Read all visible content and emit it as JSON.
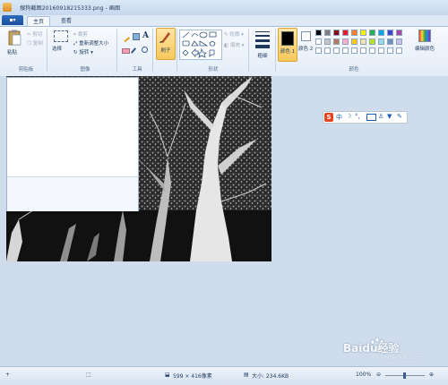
{
  "window": {
    "title": "搜狗截图20160918215333.png - 画图"
  },
  "tabs": [
    {
      "label": "主页"
    },
    {
      "label": "查看"
    }
  ],
  "clipboard": {
    "paste": "粘贴",
    "cut": "剪切",
    "copy": "复制",
    "group": "剪贴板"
  },
  "image": {
    "select": "选择",
    "crop": "裁剪",
    "resize": "重新调整大小",
    "rotate": "旋转",
    "group": "图像"
  },
  "tools": {
    "group": "工具",
    "text_glyph": "A"
  },
  "brushes": {
    "label": "刷子"
  },
  "shapes": {
    "outline": "轮廓",
    "fill": "填充",
    "group": "形状"
  },
  "size": {
    "label": "粗细"
  },
  "colors": {
    "color1": "颜色 1",
    "color2": "颜色 2",
    "edit": "编辑颜色",
    "group": "颜色",
    "palette": [
      "#000000",
      "#7f7f7f",
      "#880015",
      "#ed1c24",
      "#ff7f27",
      "#fff200",
      "#22b14c",
      "#00a2e8",
      "#3f48cc",
      "#a349a4",
      "#ffffff",
      "#c3c3c3",
      "#b97a57",
      "#ffaec9",
      "#ffc90e",
      "#efe4b0",
      "#b5e61d",
      "#99d9ea",
      "#7092be",
      "#c8bfe7",
      "#ffffff",
      "#ffffff",
      "#ffffff",
      "#ffffff",
      "#ffffff",
      "#ffffff",
      "#ffffff",
      "#ffffff",
      "#ffffff",
      "#ffffff"
    ]
  },
  "ime": {
    "logo": "S",
    "mode": "中"
  },
  "status": {
    "dimensions": "599 × 416像素",
    "filesize": "大小: 234.6KB",
    "zoom": "100%"
  },
  "watermark": {
    "text": "Baidu经验",
    "url": "jingyan.baidu.com"
  }
}
